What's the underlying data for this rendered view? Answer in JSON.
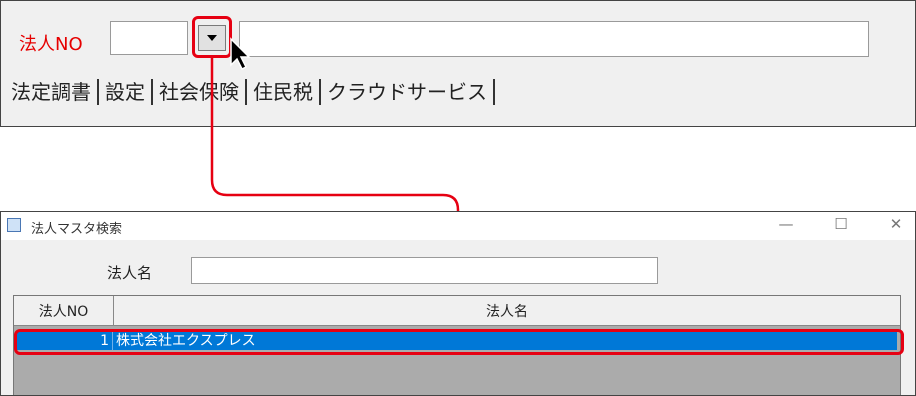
{
  "top": {
    "label": "法人NO",
    "combo_value": "",
    "name_value": "",
    "menu": [
      "法定調書",
      "設定",
      "社会保険",
      "住民税",
      "クラウドサービス"
    ]
  },
  "dialog": {
    "title": "法人マスタ検索",
    "controls": {
      "minimize": "—",
      "maximize": "☐",
      "close": "✕"
    },
    "search_label": "法人名",
    "search_value": "",
    "columns": [
      "法人NO",
      "法人名"
    ],
    "rows": [
      {
        "no": "1",
        "name": "株式会社エクスプレス"
      }
    ]
  },
  "colors": {
    "highlight": "#e60012",
    "selection": "#0078d7",
    "label_red": "#e60000"
  }
}
